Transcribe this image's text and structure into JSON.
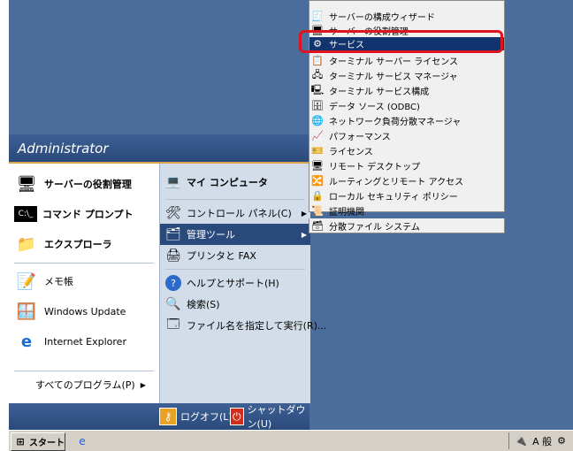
{
  "start_menu": {
    "user": "Administrator",
    "left_items": [
      {
        "label": "サーバーの役割管理",
        "icon": "server-manage-icon"
      },
      {
        "label": "コマンド プロンプト",
        "icon": "command-prompt-icon"
      },
      {
        "label": "エクスプローラ",
        "icon": "explorer-icon"
      },
      {
        "label": "メモ帳",
        "icon": "notepad-icon"
      },
      {
        "label": "Windows Update",
        "icon": "windows-update-icon"
      },
      {
        "label": "Internet Explorer",
        "icon": "internet-explorer-icon"
      }
    ],
    "all_programs": "すべてのプログラム(P)",
    "right_items": [
      {
        "label": "マイ コンピュータ",
        "icon": "my-computer-icon"
      },
      {
        "label": "コントロール パネル(C)",
        "icon": "control-panel-icon"
      },
      {
        "label": "管理ツール",
        "icon": "admin-tools-icon"
      },
      {
        "label": "プリンタと FAX",
        "icon": "printer-icon"
      },
      {
        "label": "ヘルプとサポート(H)",
        "icon": "help-icon"
      },
      {
        "label": "検索(S)",
        "icon": "search-icon"
      },
      {
        "label": "ファイル名を指定して実行(R)...",
        "icon": "run-icon"
      }
    ],
    "logoff": "ログオフ(L)",
    "shutdown": "シャットダウン(U)"
  },
  "admin_tools": [
    {
      "label": "サーバーの構成ウィザード",
      "icon": "wizard-icon"
    },
    {
      "label": "サーバーの役割管理",
      "icon": "server-manage-icon"
    },
    {
      "label": "サービス",
      "icon": "services-icon"
    },
    {
      "label": "ターミナル サーバー ライセンス",
      "icon": "terminal-license-icon"
    },
    {
      "label": "ターミナル サービス マネージャ",
      "icon": "terminal-manager-icon"
    },
    {
      "label": "ターミナル サービス構成",
      "icon": "terminal-config-icon"
    },
    {
      "label": "データ ソース (ODBC)",
      "icon": "odbc-icon"
    },
    {
      "label": "ネットワーク負荷分散マネージャ",
      "icon": "nlb-icon"
    },
    {
      "label": "パフォーマンス",
      "icon": "performance-icon"
    },
    {
      "label": "ライセンス",
      "icon": "license-icon"
    },
    {
      "label": "リモート デスクトップ",
      "icon": "remote-desktop-icon"
    },
    {
      "label": "ルーティングとリモート アクセス",
      "icon": "routing-icon"
    },
    {
      "label": "ローカル セキュリティ ポリシー",
      "icon": "security-policy-icon"
    },
    {
      "label": "証明機関",
      "icon": "certificate-icon"
    },
    {
      "label": "分散ファイル システム",
      "icon": "dfs-icon"
    }
  ],
  "taskbar": {
    "start_label": "スタート",
    "tray_text": "A 般"
  },
  "colors": {
    "desktop": "#4b6d9c",
    "highlight": "#12346e",
    "annotation": "#e0141e"
  }
}
